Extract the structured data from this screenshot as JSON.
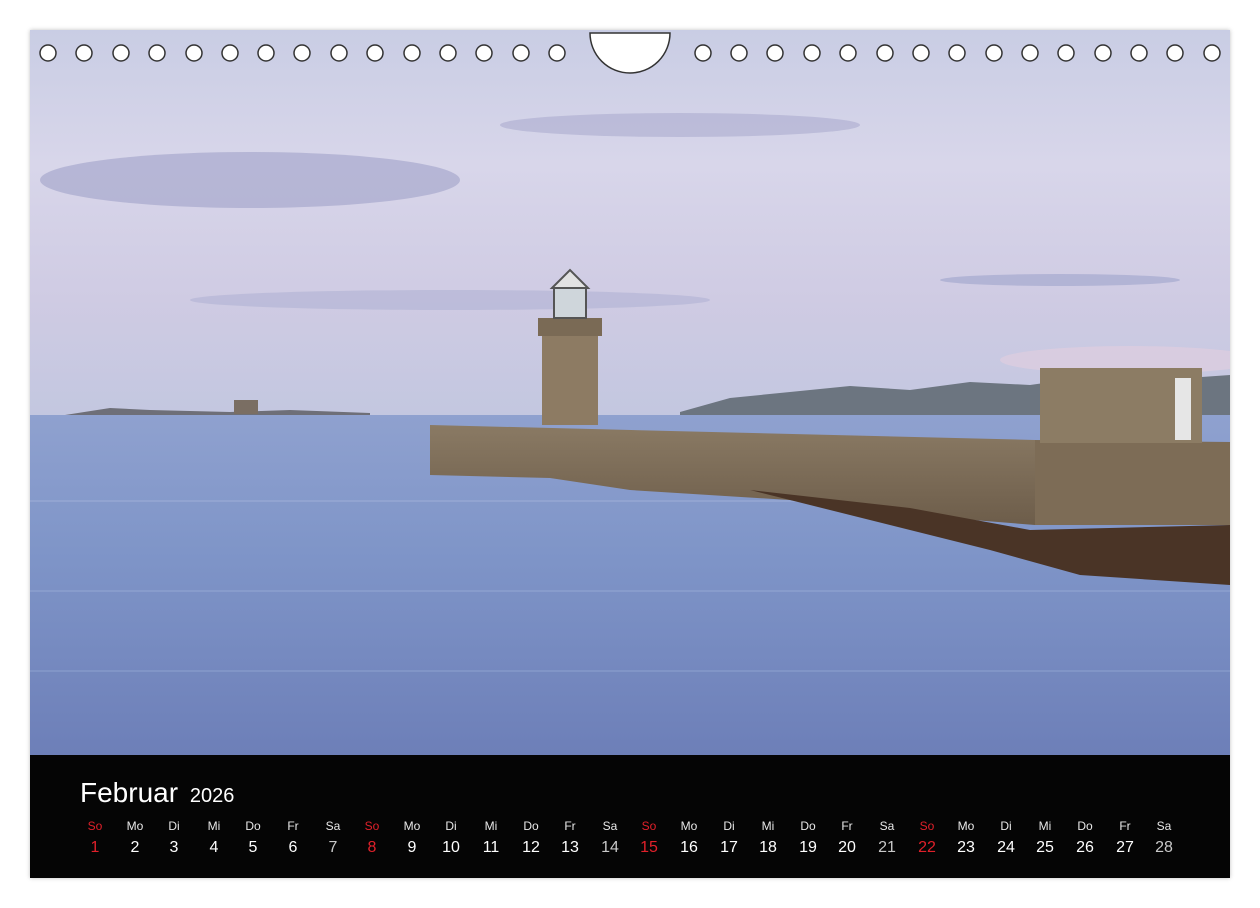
{
  "calendar": {
    "month": "Februar",
    "year": "2026",
    "sunday_color": "#e0202a",
    "days": [
      {
        "wd": "So",
        "num": "1"
      },
      {
        "wd": "Mo",
        "num": "2"
      },
      {
        "wd": "Di",
        "num": "3"
      },
      {
        "wd": "Mi",
        "num": "4"
      },
      {
        "wd": "Do",
        "num": "5"
      },
      {
        "wd": "Fr",
        "num": "6"
      },
      {
        "wd": "Sa",
        "num": "7"
      },
      {
        "wd": "So",
        "num": "8"
      },
      {
        "wd": "Mo",
        "num": "9"
      },
      {
        "wd": "Di",
        "num": "10"
      },
      {
        "wd": "Mi",
        "num": "11"
      },
      {
        "wd": "Do",
        "num": "12"
      },
      {
        "wd": "Fr",
        "num": "13"
      },
      {
        "wd": "Sa",
        "num": "14"
      },
      {
        "wd": "So",
        "num": "15"
      },
      {
        "wd": "Mo",
        "num": "16"
      },
      {
        "wd": "Di",
        "num": "17"
      },
      {
        "wd": "Mi",
        "num": "18"
      },
      {
        "wd": "Do",
        "num": "19"
      },
      {
        "wd": "Fr",
        "num": "20"
      },
      {
        "wd": "Sa",
        "num": "21"
      },
      {
        "wd": "So",
        "num": "22"
      },
      {
        "wd": "Mo",
        "num": "23"
      },
      {
        "wd": "Di",
        "num": "24"
      },
      {
        "wd": "Mi",
        "num": "25"
      },
      {
        "wd": "Do",
        "num": "26"
      },
      {
        "wd": "Fr",
        "num": "27"
      },
      {
        "wd": "Sa",
        "num": "28"
      }
    ]
  },
  "photo": {
    "icon": "lighthouse-pier-photo",
    "sky_top": "#c9cde4",
    "sea_color": "#7f95c8"
  }
}
